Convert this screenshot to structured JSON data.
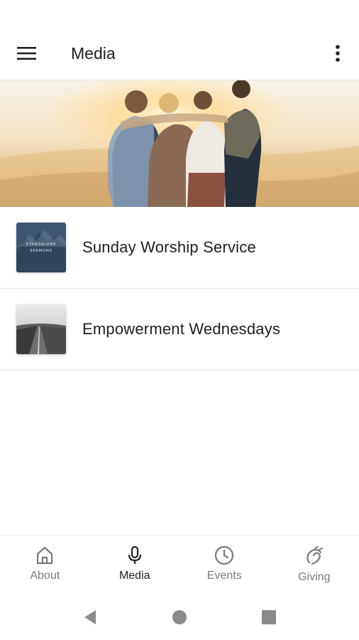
{
  "app_bar": {
    "title": "Media",
    "menu_icon": "hamburger-menu-icon",
    "more_icon": "more-vert-icon"
  },
  "hero": {
    "image": "group-hugging-at-sunset-image"
  },
  "media_list": [
    {
      "label": "Sunday Worship Service",
      "thumb_text_line1": "STANDALONE",
      "thumb_text_line2": "SERMONS",
      "thumb_icon": "mountain-thumbnail-icon"
    },
    {
      "label": "Empowerment Wednesdays",
      "thumb_icon": "road-thumbnail-icon"
    }
  ],
  "bottom_nav": {
    "items": [
      {
        "label": "About",
        "icon": "home-icon",
        "active": false
      },
      {
        "label": "Media",
        "icon": "microphone-icon",
        "active": true
      },
      {
        "label": "Events",
        "icon": "clock-icon",
        "active": false
      },
      {
        "label": "Giving",
        "icon": "giving-hand-icon",
        "active": false
      }
    ]
  },
  "colors": {
    "active": "#222222",
    "inactive": "#7a7a7a",
    "divider": "#e6e6e6",
    "system_nav": "#8a8a8a"
  }
}
